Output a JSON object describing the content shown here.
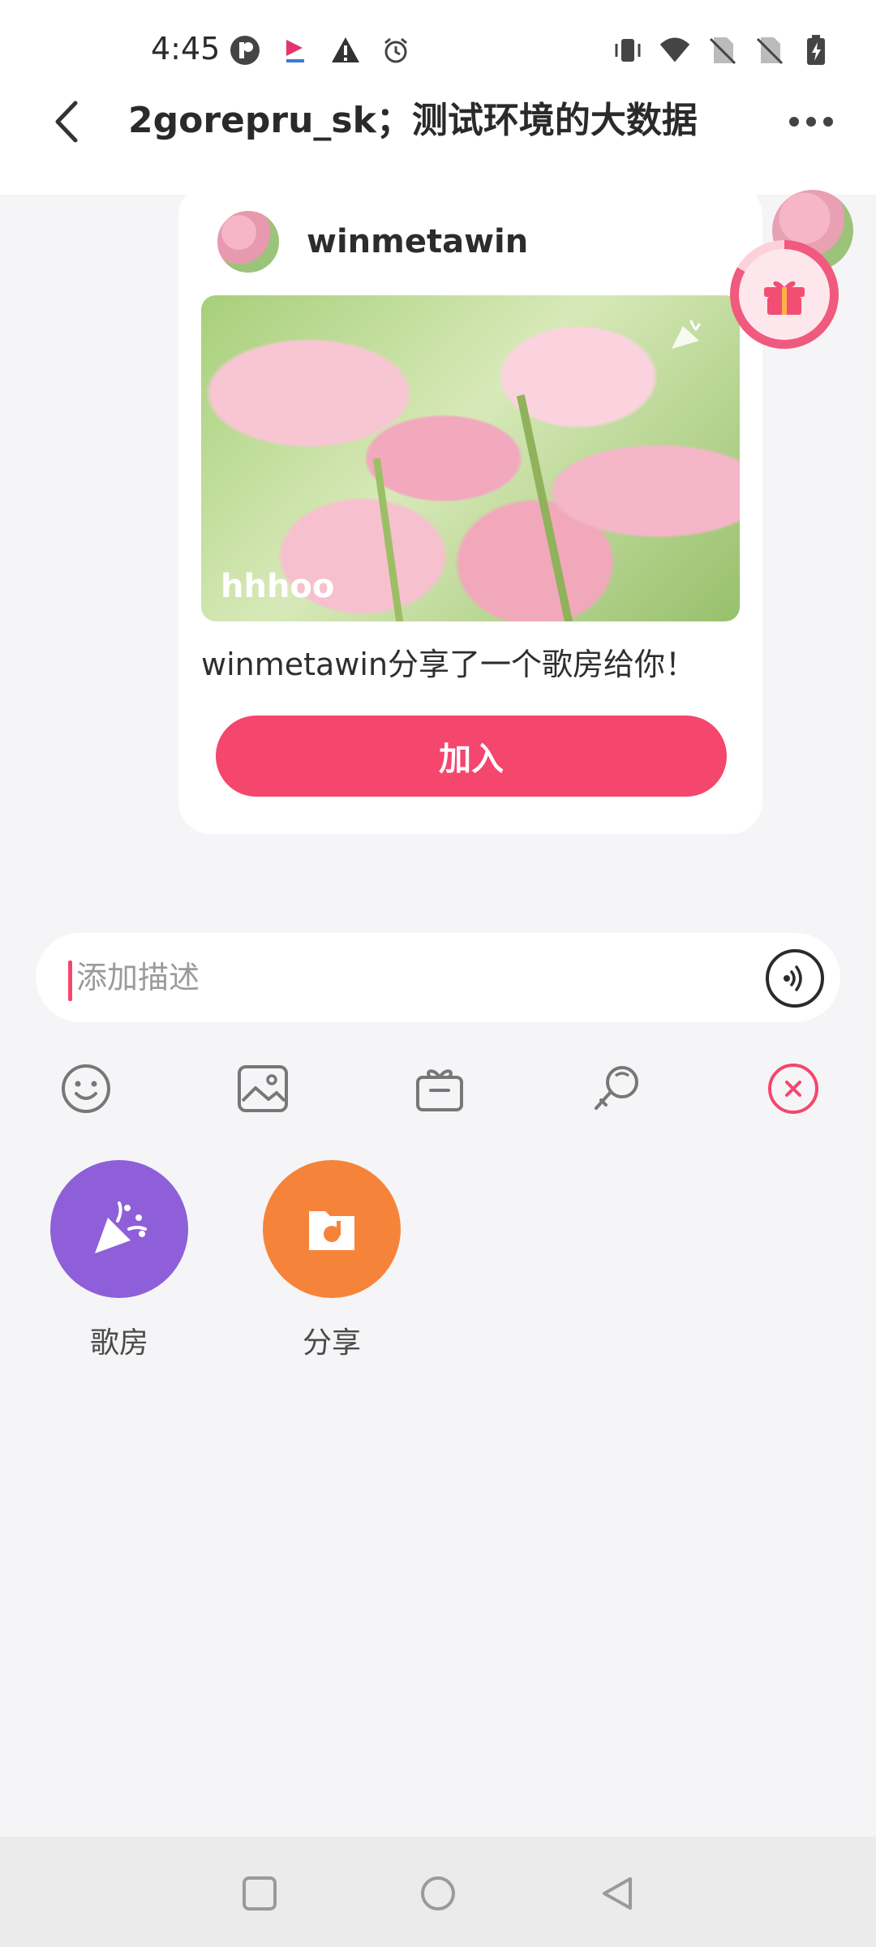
{
  "status_bar": {
    "time": "4:45",
    "left_icons": [
      "app-icon",
      "app-icon-2",
      "warning-icon",
      "alarm-icon"
    ],
    "right_icons": [
      "vibrate-icon",
      "wifi-icon",
      "no-sim-icon",
      "no-sim-icon-2",
      "battery-charging-icon"
    ]
  },
  "header": {
    "title": "2gorepru_sk；测试环境的大数据"
  },
  "message_card": {
    "sender_name": "winmetawin",
    "room_name": "hhhoo",
    "share_text": "winmetawin分享了一个歌房给你！",
    "join_label": "加入"
  },
  "input": {
    "placeholder": "添加描述",
    "value": ""
  },
  "toolbar": {
    "items": [
      "emoji-icon",
      "image-icon",
      "gift-box-icon",
      "mic-icon",
      "close-icon"
    ]
  },
  "features": [
    {
      "label": "歌房",
      "color": "#8e5fd9"
    },
    {
      "label": "分享",
      "color": "#f5843a"
    }
  ],
  "colors": {
    "accent": "#f5466e"
  }
}
